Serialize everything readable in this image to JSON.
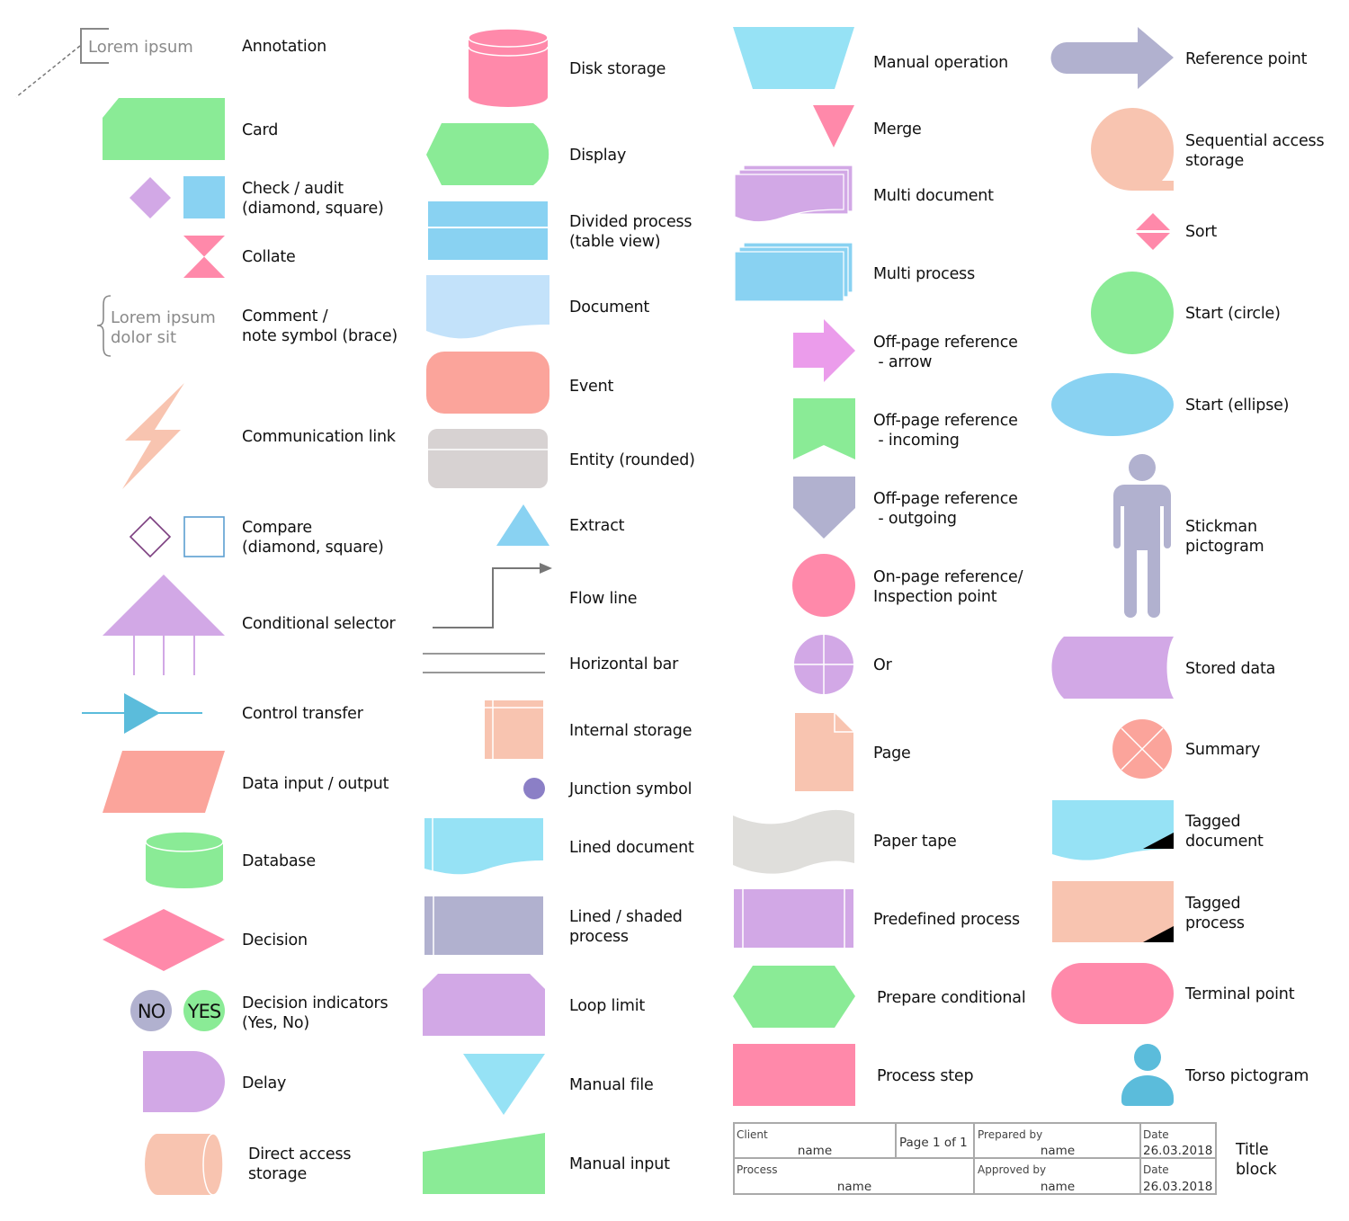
{
  "colors": {
    "green": "#8aeb96",
    "pink": "#ff89aa",
    "lilac": "#d2a8e6",
    "sky": "#89d2f2",
    "cyan": "#96e2f5",
    "light_blue": "#c3e2fa",
    "salmon": "#fba49b",
    "peach": "#f8c4b0",
    "slate": "#b1b1cf",
    "gray": "#d7d2d2",
    "paper": "#dfdedb",
    "magenta": "#eb9ceb",
    "junction": "#8b7fc6",
    "control": "#5bbcdb",
    "outline_diamond": "#7c3f80",
    "outline_square": "#5c9ed0",
    "line_gray": "#777777"
  },
  "columns": [
    {
      "items": [
        {
          "id": "annotation",
          "label": "Annotation",
          "sample_text": "Lorem ipsum"
        },
        {
          "id": "card",
          "label": "Card"
        },
        {
          "id": "check-audit",
          "label": "Check / audit\n(diamond, square)"
        },
        {
          "id": "collate",
          "label": "Collate"
        },
        {
          "id": "comment",
          "label": "Comment /\nnote symbol (brace)",
          "sample_text_1": "Lorem ipsum",
          "sample_text_2": "dolor sit"
        },
        {
          "id": "communication-link",
          "label": "Communication link"
        },
        {
          "id": "compare",
          "label": "Compare\n(diamond, square)"
        },
        {
          "id": "conditional-selector",
          "label": "Conditional selector"
        },
        {
          "id": "control-transfer",
          "label": "Control transfer"
        },
        {
          "id": "data-io",
          "label": "Data input / output"
        },
        {
          "id": "database",
          "label": "Database"
        },
        {
          "id": "decision",
          "label": "Decision"
        },
        {
          "id": "decision-indicators",
          "label": "Decision indicators\n(Yes, No)",
          "no_text": "NO",
          "yes_text": "YES"
        },
        {
          "id": "delay",
          "label": "Delay"
        },
        {
          "id": "direct-access-storage",
          "label": "Direct access\nstorage"
        }
      ]
    },
    {
      "items": [
        {
          "id": "disk-storage",
          "label": "Disk storage"
        },
        {
          "id": "display",
          "label": "Display"
        },
        {
          "id": "divided-process",
          "label": "Divided process\n(table view)"
        },
        {
          "id": "document",
          "label": "Document"
        },
        {
          "id": "event",
          "label": "Event"
        },
        {
          "id": "entity-rounded",
          "label": "Entity (rounded)"
        },
        {
          "id": "extract",
          "label": "Extract"
        },
        {
          "id": "flow-line",
          "label": "Flow line"
        },
        {
          "id": "horizontal-bar",
          "label": "Horizontal bar"
        },
        {
          "id": "internal-storage",
          "label": "Internal storage"
        },
        {
          "id": "junction-symbol",
          "label": "Junction symbol"
        },
        {
          "id": "lined-document",
          "label": "Lined document"
        },
        {
          "id": "lined-shaded-process",
          "label": "Lined / shaded\nprocess"
        },
        {
          "id": "loop-limit",
          "label": "Loop limit"
        },
        {
          "id": "manual-file",
          "label": "Manual file"
        },
        {
          "id": "manual-input",
          "label": "Manual input"
        }
      ]
    },
    {
      "items": [
        {
          "id": "manual-operation",
          "label": "Manual operation"
        },
        {
          "id": "merge",
          "label": "Merge"
        },
        {
          "id": "multi-document",
          "label": "Multi document"
        },
        {
          "id": "multi-process",
          "label": "Multi process"
        },
        {
          "id": "off-page-arrow",
          "label": "Off-page reference\n - arrow"
        },
        {
          "id": "off-page-incoming",
          "label": "Off-page reference\n - incoming"
        },
        {
          "id": "off-page-outgoing",
          "label": "Off-page reference\n - outgoing"
        },
        {
          "id": "on-page-reference",
          "label": "On-page reference/\nInspection point"
        },
        {
          "id": "or",
          "label": "Or"
        },
        {
          "id": "page",
          "label": "Page"
        },
        {
          "id": "paper-tape",
          "label": "Paper tape"
        },
        {
          "id": "predefined-process",
          "label": "Predefined process"
        },
        {
          "id": "prepare-conditional",
          "label": "Prepare conditional"
        },
        {
          "id": "process-step",
          "label": "Process step"
        }
      ]
    },
    {
      "items": [
        {
          "id": "reference-point",
          "label": "Reference point"
        },
        {
          "id": "sequential-access-storage",
          "label": "Sequential access\nstorage"
        },
        {
          "id": "sort",
          "label": "Sort"
        },
        {
          "id": "start-circle",
          "label": "Start (circle)"
        },
        {
          "id": "start-ellipse",
          "label": "Start (ellipse)"
        },
        {
          "id": "stickman",
          "label": "Stickman\npictogram"
        },
        {
          "id": "stored-data",
          "label": "Stored data"
        },
        {
          "id": "summary",
          "label": "Summary"
        },
        {
          "id": "tagged-document",
          "label": "Tagged\ndocument"
        },
        {
          "id": "tagged-process",
          "label": "Tagged\nprocess"
        },
        {
          "id": "terminal-point",
          "label": "Terminal point"
        },
        {
          "id": "torso",
          "label": "Torso pictogram"
        }
      ]
    }
  ],
  "title_block": {
    "label": "Title\nblock",
    "client_label": "Client",
    "client_value": "name",
    "page_text": "Page 1  of  1",
    "prepared_by_label": "Prepared by",
    "prepared_by_value": "name",
    "date1_label": "Date",
    "date1_value": "26.03.2018",
    "process_label": "Process",
    "process_value": "name",
    "approved_by_label": "Approved by",
    "approved_by_value": "name",
    "date2_label": "Date",
    "date2_value": "26.03.2018"
  }
}
